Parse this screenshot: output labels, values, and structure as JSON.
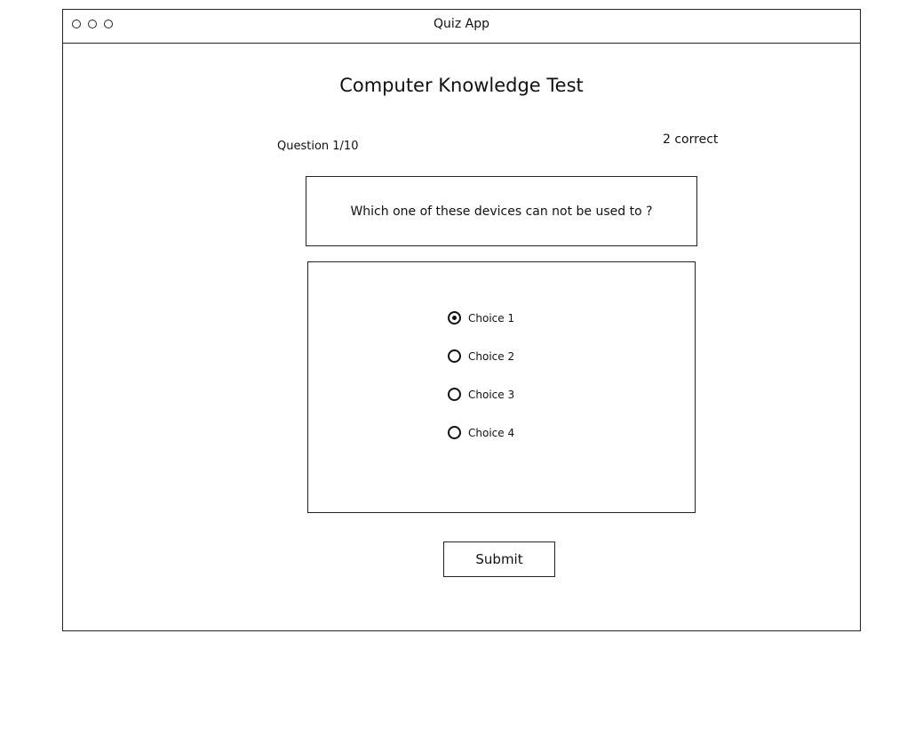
{
  "window": {
    "title": "Quiz App"
  },
  "quiz": {
    "title": "Computer Knowledge Test",
    "question_counter": "Question 1/10",
    "score": "2 correct",
    "question": "Which one of these devices can not be used to ?",
    "choices": [
      {
        "label": "Choice 1",
        "selected": true
      },
      {
        "label": "Choice 2",
        "selected": false
      },
      {
        "label": "Choice 3",
        "selected": false
      },
      {
        "label": "Choice 4",
        "selected": false
      }
    ],
    "submit_label": "Submit"
  }
}
